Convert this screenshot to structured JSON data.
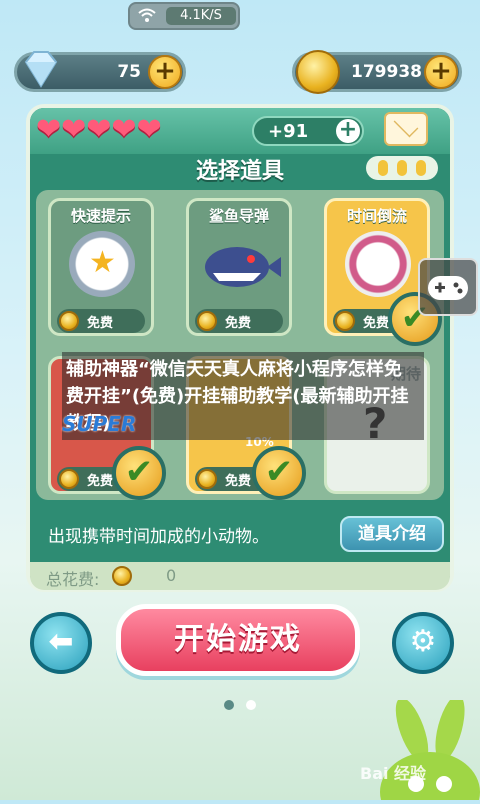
{
  "status": {
    "speed": "4.1K/S"
  },
  "currency": {
    "diamonds": "75",
    "coins": "179938"
  },
  "lives": {
    "count": 5,
    "bonus": "+91"
  },
  "panel": {
    "title": "选择道具"
  },
  "items": [
    {
      "name": "快速提示",
      "price": "免费",
      "icon": "magnifier-star-icon",
      "selected": false
    },
    {
      "name": "鲨鱼导弹",
      "price": "免费",
      "icon": "shark-missile-icon",
      "selected": false
    },
    {
      "name": "时间倒流",
      "price": "免费",
      "icon": "stopwatch-icon",
      "selected": true
    }
  ],
  "items_row2_labels": {
    "tag": "10%",
    "partial_name": "期待"
  },
  "description": "出现携带时间加成的小动物。",
  "intro_button": "道具介绍",
  "total": {
    "label": "总花费:",
    "value": "0"
  },
  "start_button": "开始游戏",
  "overlay": {
    "text": "辅助神器“微信天天真人麻将小程序怎样免费开挂”(免费)开挂辅助教学(最新辅助开挂教程)",
    "super": "SUPER"
  },
  "watermark": "Bai 经验",
  "colors": {
    "panel": "#2e8c73",
    "start": "#e8405f",
    "accent": "#f2c33a"
  }
}
